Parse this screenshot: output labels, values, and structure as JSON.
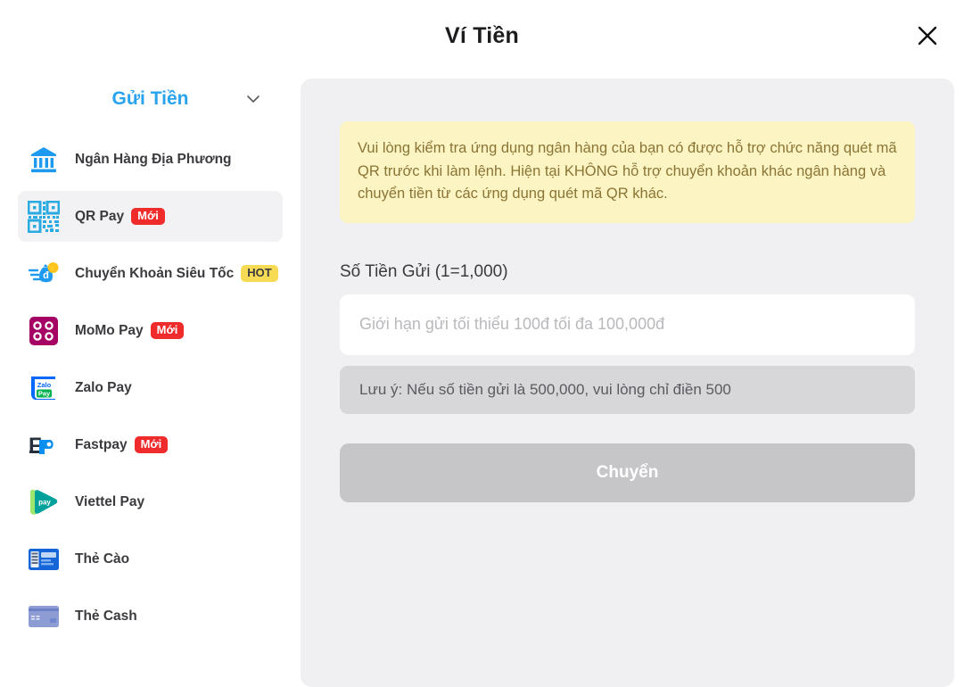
{
  "header": {
    "title": "Ví Tiền",
    "close_icon": "close-icon"
  },
  "sidebar": {
    "title": "Gửi Tiền",
    "chevron_icon": "chevron-down-icon",
    "items": [
      {
        "label": "Ngân Hàng Địa Phương",
        "icon": "bank-icon",
        "badge": "",
        "selected": false
      },
      {
        "label": "QR Pay",
        "icon": "qr-code-icon",
        "badge": "Mới",
        "badge_type": "new",
        "selected": true
      },
      {
        "label": "Chuyển Khoản Siêu Tốc",
        "icon": "money-bag-icon",
        "badge": "HOT",
        "badge_type": "hot",
        "selected": false
      },
      {
        "label": "MoMo Pay",
        "icon": "momo-icon",
        "badge": "Mới",
        "badge_type": "new",
        "selected": false
      },
      {
        "label": "Zalo Pay",
        "icon": "zalopay-icon",
        "badge": "",
        "selected": false
      },
      {
        "label": "Fastpay",
        "icon": "fastpay-icon",
        "badge": "Mới",
        "badge_type": "new",
        "selected": false
      },
      {
        "label": "Viettel Pay",
        "icon": "viettelpay-icon",
        "badge": "",
        "selected": false
      },
      {
        "label": "Thẻ Cào",
        "icon": "scratch-card-icon",
        "badge": "",
        "selected": false
      },
      {
        "label": "Thẻ Cash",
        "icon": "cash-card-icon",
        "badge": "",
        "selected": false
      }
    ]
  },
  "main": {
    "notice": "Vui lòng kiểm tra ứng dụng ngân hàng của bạn có được hỗ trợ chức năng quét mã QR trước khi làm lệnh. Hiện tại KHÔNG hỗ trợ chuyển khoản khác ngân hàng và chuyển tiền từ các ứng dụng quét mã QR khác.",
    "amount_label": "Số Tiền Gửi (1=1,000)",
    "amount_value": "",
    "amount_placeholder": "Giới hạn gửi tối thiểu 100đ tối đa 100,000đ",
    "hint": "Lưu ý: Nếu số tiền gửi là 500,000, vui lòng chỉ điền 500",
    "submit_label": "Chuyển"
  },
  "colors": {
    "accent_blue": "#2aa3ef",
    "badge_new": "#f02b2b",
    "badge_hot": "#f8db55",
    "notice_bg": "#fdf4c3",
    "notice_text": "#8a7535",
    "panel_bg": "#f0f0f2",
    "submit_bg": "#c6c6c9"
  }
}
